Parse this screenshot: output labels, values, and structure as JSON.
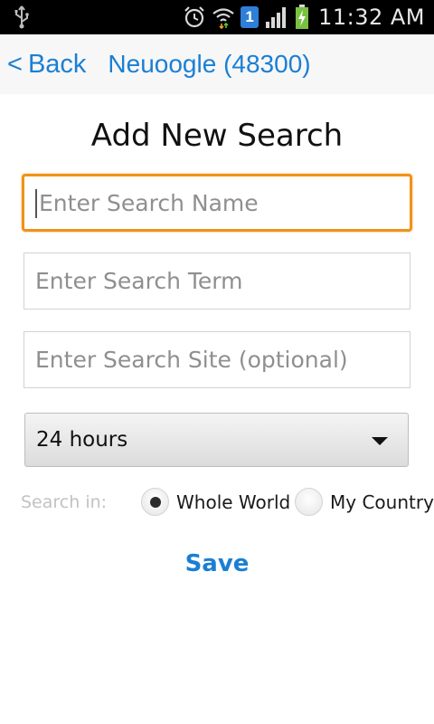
{
  "status_bar": {
    "time": "11:32 AM",
    "icons": [
      "usb-icon",
      "alarm-icon",
      "wifi-icon",
      "sim-icon",
      "signal-icon",
      "battery-icon"
    ],
    "sim_number": "1"
  },
  "nav": {
    "back_chevron": "<",
    "back_label": "Back",
    "title": "Neuoogle (48300)"
  },
  "form": {
    "heading": "Add New Search",
    "search_name_placeholder": "Enter Search Name",
    "search_term_placeholder": "Enter Search Term",
    "search_site_placeholder": "Enter Search Site (optional)",
    "time_range": "24 hours",
    "search_in_label": "Search in:",
    "scope_options": [
      {
        "label": "Whole World",
        "selected": true
      },
      {
        "label": "My Country",
        "selected": false
      }
    ],
    "save_label": "Save"
  },
  "colors": {
    "accent": "#1a7fd4",
    "focus": "#f0921a"
  }
}
